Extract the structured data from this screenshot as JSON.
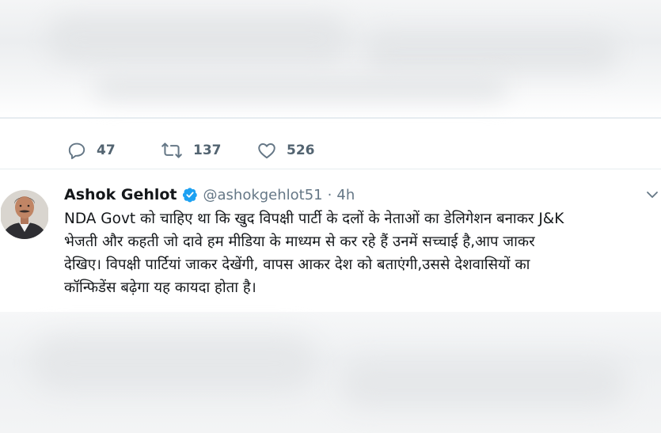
{
  "previous_tweet": {
    "actions": {
      "reply_count": "47",
      "retweet_count": "137",
      "like_count": "526"
    }
  },
  "tweet": {
    "display_name": "Ashok Gehlot",
    "handle": "@ashokgehlot51",
    "separator": "·",
    "time": "4h",
    "lines": [
      "NDA Govt को चाहिए था कि खुद विपक्षी पार्टी के दलों के नेताओं का डेलिगेशन बनाकर J&K",
      "भेजती और कहती जो दावे हम मीडिया के माध्यम से कर रहे हैं उनमें सच्चाई है,आप जाकर",
      "देखिए। विपक्षी पार्टियां जाकर देखेंगी, वापस आकर देश को बताएंगी,उससे देशवासियों का",
      "कॉन्फिडेंस बढ़ेगा यह कायदा होता है।"
    ]
  },
  "colors": {
    "accent": "#1da1f2",
    "muted_text": "#657786",
    "primary_text": "#14171a",
    "border": "#e6ecf0"
  },
  "icons": {
    "reply": "reply-icon",
    "retweet": "retweet-icon",
    "like": "heart-icon",
    "verified": "verified-badge-icon",
    "more": "chevron-down-icon"
  }
}
